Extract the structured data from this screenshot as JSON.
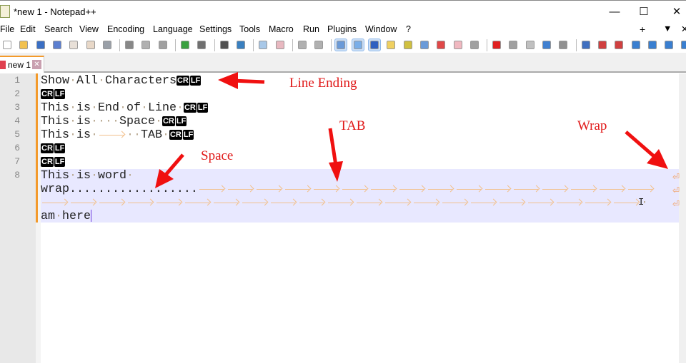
{
  "window": {
    "title": "*new 1 - Notepad++",
    "minimize": "—",
    "maximize": "☐",
    "close": "✕"
  },
  "menu": [
    "File",
    "Edit",
    "Search",
    "View",
    "Encoding",
    "Language",
    "Settings",
    "Tools",
    "Macro",
    "Run",
    "Plugins",
    "Window",
    "?"
  ],
  "menu_right": {
    "plus": "+",
    "dropdown": "▼",
    "close": "✕"
  },
  "toolbar": [
    {
      "name": "new-file-icon",
      "color": "#ffffff"
    },
    {
      "name": "open-file-icon",
      "color": "#f2c14e"
    },
    {
      "name": "save-icon",
      "color": "#3a6fc4"
    },
    {
      "name": "save-all-icon",
      "color": "#5c7fd0"
    },
    {
      "name": "close-icon",
      "color": "#e8e0d8"
    },
    {
      "name": "close-all-icon",
      "color": "#e8d8c8"
    },
    {
      "name": "print-icon",
      "color": "#9aa0a8"
    },
    {
      "name": "cut-icon",
      "color": "#888888"
    },
    {
      "name": "copy-icon",
      "color": "#b0b0b0"
    },
    {
      "name": "paste-icon",
      "color": "#a0a0a0"
    },
    {
      "name": "undo-icon",
      "color": "#3aa040"
    },
    {
      "name": "redo-icon",
      "color": "#707070"
    },
    {
      "name": "find-icon",
      "color": "#505050"
    },
    {
      "name": "replace-icon",
      "color": "#3a80c0"
    },
    {
      "name": "zoom-in-icon",
      "color": "#a8c8e8"
    },
    {
      "name": "zoom-out-icon",
      "color": "#e8b8c0"
    },
    {
      "name": "sync-vertical-icon",
      "color": "#b0b0b0"
    },
    {
      "name": "sync-horizontal-icon",
      "color": "#b0b0b0"
    },
    {
      "name": "word-wrap-icon",
      "color": "#6a9ad8",
      "active": true
    },
    {
      "name": "show-all-characters-icon",
      "color": "#7aaee8",
      "active": true
    },
    {
      "name": "indent-guide-icon",
      "color": "#3060c0",
      "active": true
    },
    {
      "name": "user-language-icon",
      "color": "#f0d060"
    },
    {
      "name": "document-map-icon",
      "color": "#d0c040"
    },
    {
      "name": "document-list-icon",
      "color": "#6a9ad8"
    },
    {
      "name": "function-list-icon",
      "color": "#e04848"
    },
    {
      "name": "folder-workspace-icon",
      "color": "#f0b8c0"
    },
    {
      "name": "monitoring-icon",
      "color": "#a0a0a0"
    },
    {
      "name": "record-macro-icon",
      "color": "#e02020"
    },
    {
      "name": "stop-macro-icon",
      "color": "#a0a0a0"
    },
    {
      "name": "play-macro-icon",
      "color": "#c0c0c0"
    },
    {
      "name": "run-macro-multiple-icon",
      "color": "#4080d0"
    },
    {
      "name": "save-macro-icon",
      "color": "#909090"
    },
    {
      "name": "bookmark-icon",
      "color": "#4070c0"
    },
    {
      "name": "compare-icon",
      "color": "#d04040"
    },
    {
      "name": "clear-compare-icon",
      "color": "#d04040"
    },
    {
      "name": "first-diff-icon",
      "color": "#3a7fd0"
    },
    {
      "name": "prev-diff-icon",
      "color": "#3a7fd0"
    },
    {
      "name": "next-diff-icon",
      "color": "#3a7fd0"
    },
    {
      "name": "last-diff-icon",
      "color": "#3a7fd0"
    }
  ],
  "tab": {
    "label": "new 1",
    "close": "✕"
  },
  "line_numbers": [
    "1",
    "2",
    "3",
    "4",
    "5",
    "6",
    "7",
    "8"
  ],
  "eol": {
    "cr": "CR",
    "lf": "LF"
  },
  "rows": [
    [
      [
        "t",
        "Show"
      ],
      [
        "s"
      ],
      [
        "t",
        "All"
      ],
      [
        "s"
      ],
      [
        "t",
        "Characters"
      ],
      [
        "e"
      ]
    ],
    [
      [
        "e"
      ]
    ],
    [
      [
        "t",
        "This"
      ],
      [
        "s"
      ],
      [
        "t",
        "is"
      ],
      [
        "s"
      ],
      [
        "t",
        "End"
      ],
      [
        "s"
      ],
      [
        "t",
        "of"
      ],
      [
        "s"
      ],
      [
        "t",
        "Line"
      ],
      [
        "s"
      ],
      [
        "e"
      ]
    ],
    [
      [
        "t",
        "This"
      ],
      [
        "s"
      ],
      [
        "t",
        "is"
      ],
      [
        "s"
      ],
      [
        "s"
      ],
      [
        "s"
      ],
      [
        "s"
      ],
      [
        "t",
        "Space"
      ],
      [
        "s"
      ],
      [
        "e"
      ]
    ],
    [
      [
        "t",
        "This"
      ],
      [
        "s"
      ],
      [
        "t",
        "is"
      ],
      [
        "s"
      ],
      [
        "tab"
      ],
      [
        "s"
      ],
      [
        "s"
      ],
      [
        "t",
        "TAB"
      ],
      [
        "s"
      ],
      [
        "e"
      ]
    ],
    [
      [
        "e"
      ]
    ],
    [
      [
        "e"
      ]
    ],
    [
      [
        "t",
        "This"
      ],
      [
        "s"
      ],
      [
        "t",
        "is"
      ],
      [
        "s"
      ],
      [
        "t",
        "word"
      ],
      [
        "s"
      ]
    ],
    [
      [
        "t",
        "wrap.................."
      ],
      [
        "tabs",
        16
      ]
    ],
    [
      [
        "tabs",
        21
      ],
      [
        "s"
      ]
    ],
    [
      [
        "t",
        "am"
      ],
      [
        "s"
      ],
      [
        "t",
        "here"
      ],
      [
        "caret"
      ]
    ]
  ],
  "wrap_symbol": "⏎",
  "annotations": {
    "line_ending": "Line Ending",
    "tab": "TAB",
    "wrap": "Wrap",
    "space": "Space"
  },
  "colors": {
    "accent": "#f39a2b",
    "annotation": "#e01818",
    "highlight": "#e8e8ff",
    "tab_arrow": "#f2c08c"
  }
}
